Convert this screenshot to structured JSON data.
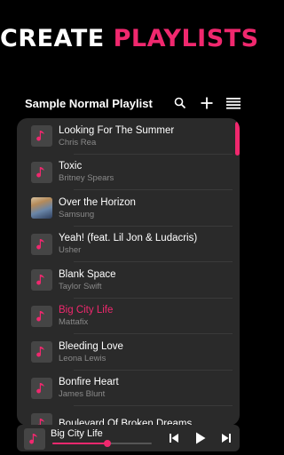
{
  "banner": {
    "word1": "CREATE",
    "word2": "PLAYLISTS"
  },
  "header": {
    "title": "Sample Normal Playlist",
    "search_icon": "search-icon",
    "add_icon": "plus-icon",
    "menu_icon": "menu-icon"
  },
  "tracks": [
    {
      "title": "Looking For The Summer",
      "artist": "Chris Rea",
      "art": "music-note-icon"
    },
    {
      "title": "Toxic",
      "artist": "Britney Spears",
      "art": "music-note-icon"
    },
    {
      "title": "Over the Horizon",
      "artist": "Samsung",
      "art": "album-art-photo"
    },
    {
      "title": "Yeah! (feat. Lil Jon & Ludacris)",
      "artist": "Usher",
      "art": "music-note-icon"
    },
    {
      "title": "Blank Space",
      "artist": "Taylor Swift",
      "art": "music-note-icon"
    },
    {
      "title": "Big City Life",
      "artist": "Mattafix",
      "art": "music-note-icon",
      "active": true
    },
    {
      "title": "Bleeding Love",
      "artist": "Leona Lewis",
      "art": "music-note-icon"
    },
    {
      "title": "Bonfire Heart",
      "artist": "James Blunt",
      "art": "music-note-icon"
    },
    {
      "title": "Boulevard Of Broken Dreams",
      "artist": "",
      "art": "music-note-icon"
    }
  ],
  "player": {
    "title": "Big City Life",
    "progress": 0.55,
    "controls": [
      "previous-icon",
      "play-icon",
      "next-icon"
    ]
  },
  "colors": {
    "accent": "#f0286e",
    "background": "#000000",
    "card": "#2a2a2a",
    "subtext": "#8a8a8a"
  }
}
